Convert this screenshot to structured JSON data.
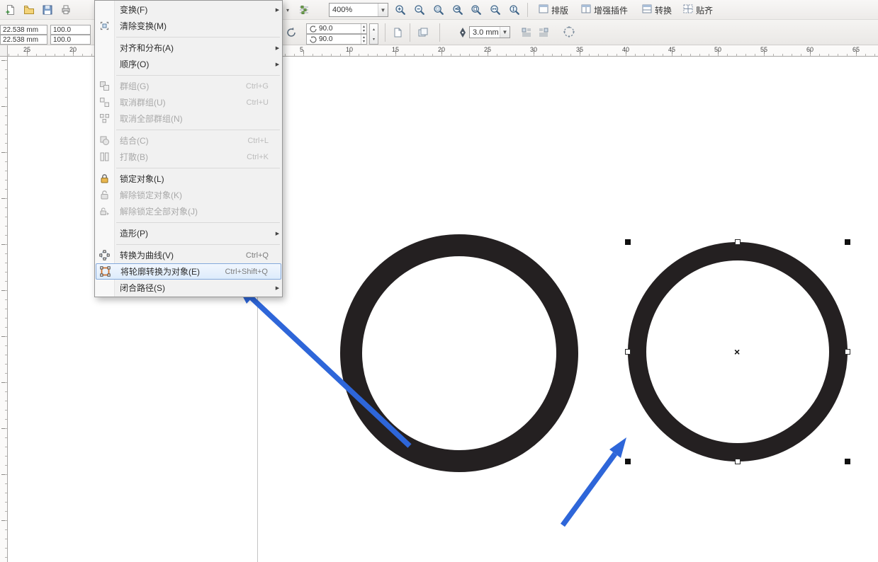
{
  "toolbar": {
    "zoom_value": "400%",
    "view_buttons": [
      {
        "id": "paiban",
        "label": "排版"
      },
      {
        "id": "zengqiang-chajian",
        "label": "增强插件"
      },
      {
        "id": "zhuanhuan",
        "label": "转换"
      },
      {
        "id": "tieqi",
        "label": "贴齐"
      }
    ]
  },
  "property_bar": {
    "object_width": "22.538 mm",
    "object_height": "22.538 mm",
    "scale_h": "100.0",
    "scale_v": "100.0",
    "angle_1": "90.0",
    "angle_2": "90.0",
    "outline_width": "3.0 mm"
  },
  "menu": {
    "items": [
      {
        "id": "transform",
        "label": "变换(F)",
        "submenu": true,
        "enabled": true
      },
      {
        "id": "clear-transformations",
        "label": "清除变换(M)",
        "icon": "clear-transform-icon",
        "enabled": true
      },
      {
        "separator": true
      },
      {
        "id": "align-and-distribute",
        "label": "对齐和分布(A)",
        "submenu": true,
        "enabled": true
      },
      {
        "id": "order",
        "label": "顺序(O)",
        "submenu": true,
        "enabled": true
      },
      {
        "separator": true
      },
      {
        "id": "group",
        "label": "群组(G)",
        "shortcut": "Ctrl+G",
        "icon": "group-icon",
        "enabled": false
      },
      {
        "id": "ungroup",
        "label": "取消群组(U)",
        "shortcut": "Ctrl+U",
        "icon": "ungroup-icon",
        "enabled": false
      },
      {
        "id": "ungroup-all",
        "label": "取消全部群组(N)",
        "icon": "ungroup-all-icon",
        "enabled": false
      },
      {
        "separator": true
      },
      {
        "id": "combine",
        "label": "结合(C)",
        "shortcut": "Ctrl+L",
        "icon": "combine-icon",
        "enabled": false
      },
      {
        "id": "break-apart",
        "label": "打散(B)",
        "shortcut": "Ctrl+K",
        "icon": "break-apart-icon",
        "enabled": false
      },
      {
        "separator": true
      },
      {
        "id": "lock-object",
        "label": "锁定对象(L)",
        "icon": "lock-icon",
        "enabled": true
      },
      {
        "id": "unlock-object",
        "label": "解除锁定对象(K)",
        "icon": "unlock-icon",
        "enabled": false
      },
      {
        "id": "unlock-all-objects",
        "label": "解除锁定全部对象(J)",
        "icon": "unlock-all-icon",
        "enabled": false
      },
      {
        "separator": true
      },
      {
        "id": "shaping",
        "label": "造形(P)",
        "submenu": true,
        "enabled": true
      },
      {
        "separator": true
      },
      {
        "id": "convert-to-curves",
        "label": "转换为曲线(V)",
        "shortcut": "Ctrl+Q",
        "icon": "convert-to-curves-icon",
        "enabled": true
      },
      {
        "id": "convert-outline-to-object",
        "label": "将轮廓转换为对象(E)",
        "shortcut": "Ctrl+Shift+Q",
        "icon": "outline-to-object-icon",
        "enabled": true,
        "highlighted": true
      },
      {
        "id": "close-path",
        "label": "闭合路径(S)",
        "submenu": true,
        "enabled": true
      }
    ]
  },
  "ruler": {
    "negative_labels": [
      "25",
      "20"
    ],
    "positive_labels": [
      "5",
      "10",
      "15",
      "20",
      "25",
      "30",
      "35",
      "40",
      "45",
      "50",
      "55",
      "60",
      "65"
    ]
  },
  "canvas": {
    "center_marker": "×"
  },
  "colors": {
    "ring": "#242021",
    "arrow": "#2e66d9",
    "menu_highlight": "#84a9dc"
  }
}
